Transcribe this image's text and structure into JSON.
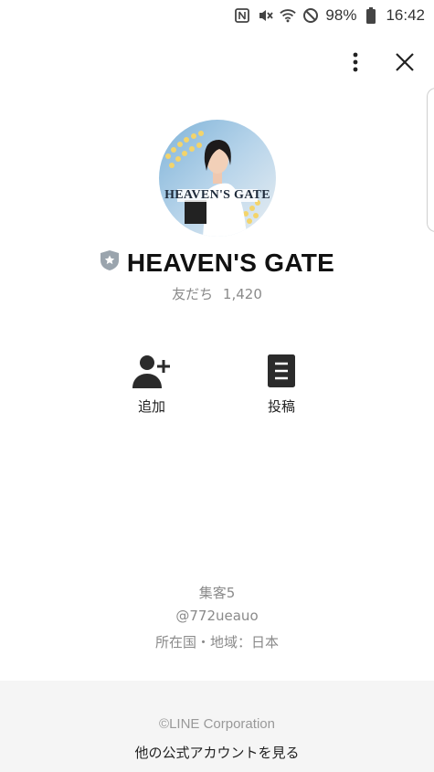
{
  "status_bar": {
    "battery": "98%",
    "time": "16:42",
    "icons": [
      "nfc-icon",
      "vibrate-mute-icon",
      "wifi-icon",
      "do-not-disturb-icon",
      "battery-icon"
    ]
  },
  "topbar": {
    "icons": [
      "more-vertical-icon",
      "close-icon"
    ]
  },
  "profile": {
    "avatar_text": "HEAVEN'S GATE",
    "name": "HEAVEN'S GATE",
    "friends_label": "友だち",
    "friends_count": "1,420",
    "badge_icon": "shield-star-icon",
    "badge_color": "#9aa4ad"
  },
  "actions": {
    "add_label": "追加",
    "post_label": "投稿"
  },
  "info": {
    "display_name": "集客5",
    "line_id": "@772ueauo",
    "region": "所在国・地域：日本"
  },
  "footer": {
    "copyright": "©LINE Corporation",
    "other_accounts": "他の公式アカウントを見る"
  }
}
